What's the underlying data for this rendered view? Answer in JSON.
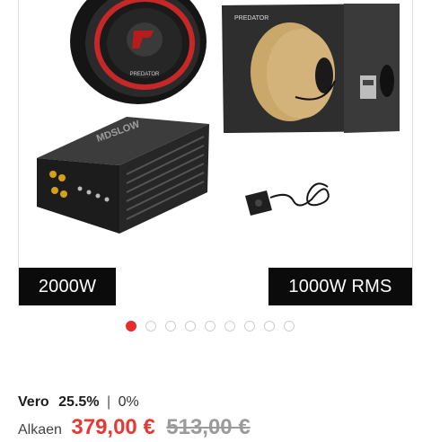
{
  "product": {
    "badges": {
      "left": "2000W",
      "right": "1000W RMS"
    },
    "image_logos": {
      "subwoofer": "PREDATOR",
      "box": "PREDATOR",
      "amplifier": "MDSLOW"
    }
  },
  "carousel": {
    "dot_count": 9,
    "active_index": 0
  },
  "vat": {
    "label": "Vero",
    "value": "25.5%",
    "separator": "|",
    "alt_value": "0%"
  },
  "pricing": {
    "from_label": "Alkaen",
    "price": "379,00 €",
    "old_price": "513,00 €"
  },
  "colors": {
    "accent": "#e53935",
    "badge_bg": "#0b0b0b",
    "dot_inactive": "#cfcfcf"
  }
}
